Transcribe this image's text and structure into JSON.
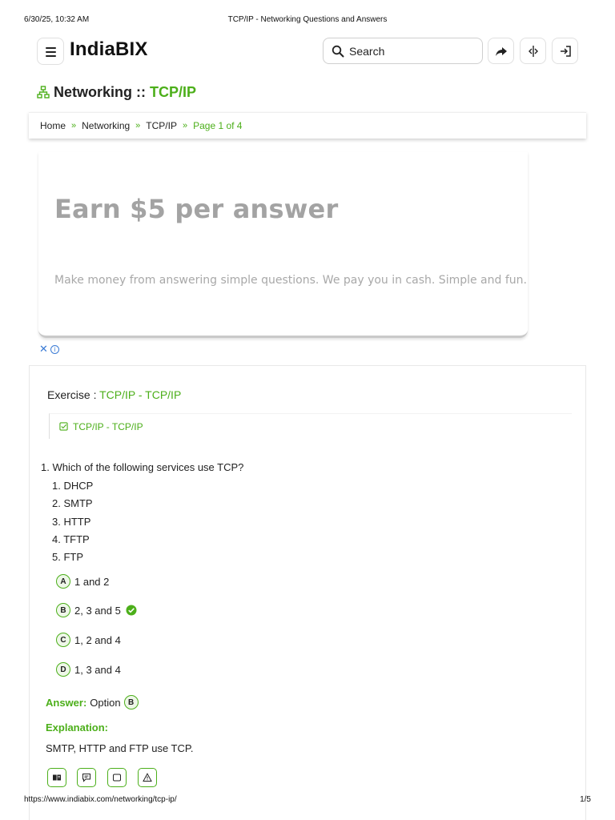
{
  "print_header": {
    "datetime": "6/30/25, 10:32 AM",
    "title": "TCP/IP - Networking Questions and Answers"
  },
  "print_footer": {
    "url": "https://www.indiabix.com/networking/tcp-ip/",
    "page": "1/5"
  },
  "header": {
    "logo": "IndiaBIX",
    "search_placeholder": "Search",
    "icons": [
      "menu-icon",
      "search-icon",
      "share-icon",
      "split-view-icon",
      "login-icon"
    ]
  },
  "section": {
    "prefix": "Networking ::",
    "topic": "TCP/IP",
    "icon": "network-icon"
  },
  "breadcrumb": {
    "items": [
      "Home",
      "Networking",
      "TCP/IP"
    ],
    "separator": "»",
    "current": "Page 1 of 4"
  },
  "ad": {
    "headline": "Earn $5 per answer",
    "subtext": "Make money from answering simple questions. We pay you in cash. Simple and fun.",
    "close_label": "✕",
    "info_label": "i"
  },
  "exercise": {
    "label": "Exercise :",
    "name": "TCP/IP - TCP/IP",
    "subtopic": "TCP/IP - TCP/IP"
  },
  "question": {
    "number": "1.",
    "text": "Which of the following services use TCP?",
    "items": [
      "1. DHCP",
      "2. SMTP",
      "3. HTTP",
      "4. TFTP",
      "5. FTP"
    ],
    "options": [
      {
        "letter": "A",
        "text": "1 and 2"
      },
      {
        "letter": "B",
        "text": "2, 3 and 5",
        "correct": true
      },
      {
        "letter": "C",
        "text": "1, 2 and 4"
      },
      {
        "letter": "D",
        "text": "1, 3 and 4"
      }
    ]
  },
  "answer": {
    "label": "Answer:",
    "prefix": "Option",
    "letter": "B"
  },
  "explanation": {
    "label": "Explanation:",
    "text": "SMTP, HTTP and FTP use TCP."
  },
  "actions": [
    "workspace-icon",
    "discuss-icon",
    "report-frame-icon",
    "warning-icon"
  ],
  "colors": {
    "accent": "#4caf1a",
    "ad_text": "#a3a3a3",
    "link_blue": "#3a7bd5"
  }
}
